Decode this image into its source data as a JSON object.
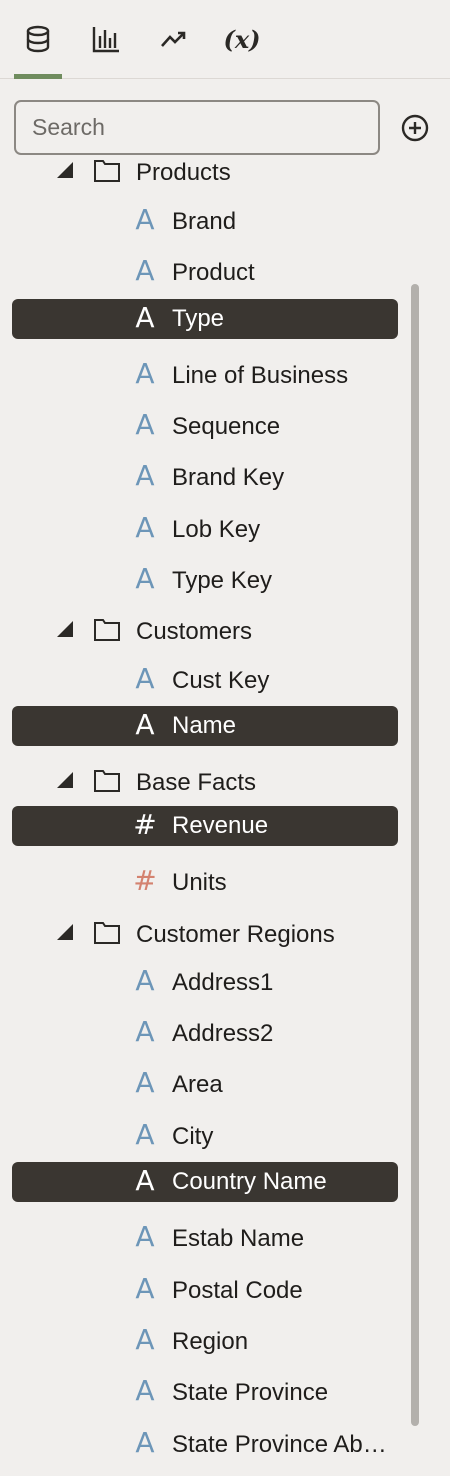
{
  "tabs": [
    {
      "id": "data",
      "icon": "database-icon",
      "active": true
    },
    {
      "id": "visualizations",
      "icon": "bar-chart-icon",
      "active": false
    },
    {
      "id": "analytics",
      "icon": "trend-line-icon",
      "active": false
    },
    {
      "id": "calculations",
      "icon": "variable-icon",
      "label": "(x)",
      "active": false
    }
  ],
  "search": {
    "placeholder": "Search",
    "value": ""
  },
  "add_icon": "add-circle-icon",
  "tree": {
    "products": {
      "label": "Products",
      "items": [
        {
          "label": "Brand",
          "kind": "attribute",
          "selected": false
        },
        {
          "label": "Product",
          "kind": "attribute",
          "selected": false
        },
        {
          "label": "Type",
          "kind": "attribute",
          "selected": true
        },
        {
          "label": "Line of Business",
          "kind": "attribute",
          "selected": false
        },
        {
          "label": "Sequence",
          "kind": "attribute",
          "selected": false
        },
        {
          "label": "Brand Key",
          "kind": "attribute",
          "selected": false
        },
        {
          "label": "Lob Key",
          "kind": "attribute",
          "selected": false
        },
        {
          "label": "Type Key",
          "kind": "attribute",
          "selected": false
        }
      ]
    },
    "customers": {
      "label": "Customers",
      "items": [
        {
          "label": "Cust Key",
          "kind": "attribute",
          "selected": false
        },
        {
          "label": "Name",
          "kind": "attribute",
          "selected": true
        }
      ]
    },
    "base_facts": {
      "label": "Base Facts",
      "items": [
        {
          "label": "Revenue",
          "kind": "measure",
          "selected": true
        },
        {
          "label": "Units",
          "kind": "measure",
          "selected": false
        }
      ]
    },
    "customer_regions": {
      "label": "Customer Regions",
      "items": [
        {
          "label": "Address1",
          "kind": "attribute",
          "selected": false
        },
        {
          "label": "Address2",
          "kind": "attribute",
          "selected": false
        },
        {
          "label": "Area",
          "kind": "attribute",
          "selected": false
        },
        {
          "label": "City",
          "kind": "attribute",
          "selected": false
        },
        {
          "label": "Country Name",
          "kind": "attribute",
          "selected": true
        },
        {
          "label": "Estab Name",
          "kind": "attribute",
          "selected": false
        },
        {
          "label": "Postal Code",
          "kind": "attribute",
          "selected": false
        },
        {
          "label": "Region",
          "kind": "attribute",
          "selected": false
        },
        {
          "label": "State Province",
          "kind": "attribute",
          "selected": false
        },
        {
          "label": "State Province Ab…",
          "kind": "attribute",
          "selected": false
        }
      ]
    }
  },
  "icons": {
    "attribute_glyph": "A",
    "measure_glyph": "#"
  },
  "colors": {
    "accent": "#6f8c5e",
    "selected_bg": "#3a3631",
    "attribute_icon": "#6d96b8",
    "measure_icon": "#d4826f",
    "background": "#f1efed"
  }
}
